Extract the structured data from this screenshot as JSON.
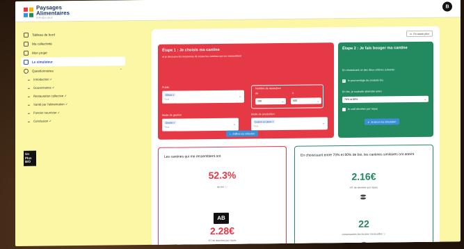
{
  "app": {
    "logo_line1": "Paysages",
    "logo_line2": "Alimentaires",
    "logo_sub": "ÉTAT DES LIEUX",
    "user_initial": "B"
  },
  "sidebar": {
    "items": [
      {
        "label": "Tableau de bord",
        "icon": "home-icon"
      },
      {
        "label": "Ma collectivité",
        "icon": "building-icon"
      },
      {
        "label": "Mon projet",
        "icon": "folder-icon"
      },
      {
        "label": "Le simulateur",
        "icon": "calculator-icon",
        "active": true
      },
      {
        "label": "Questionnaires",
        "icon": "clipboard-icon"
      }
    ],
    "subitems": [
      "Introduction ✓",
      "Gouvernance ✓",
      "Restauration collective ✓",
      "Santé par l'alimentation ✓",
      "Foncier nourricier ✓",
      "Conclusion ✓"
    ],
    "badge": [
      "Un",
      "Plus",
      "BIO"
    ]
  },
  "main": {
    "savoir_plus": "En savoir plus",
    "etape1": {
      "title": "Étape 1 : Je choisis ma cantine",
      "subtitle": "et je découvre les moyennes de toutes les cantines qui me ressemblent",
      "public_label": "Public",
      "public_tag": "Elèves ×",
      "public_placeholder": "Tous",
      "repas_label": "Nombre de repas/jour",
      "de_label": "de",
      "a_label": "à",
      "de_value": "100",
      "a_value": "500",
      "gestion_label": "Mode de gestion",
      "gestion_tag": "Directe ×",
      "gestion_placeholder": "Tous",
      "production_label": "Mode de production",
      "production_tag": "Cuisine sur place ×",
      "production_placeholder": "Tous",
      "button": "J'affine ma sélection"
    },
    "etape2": {
      "title": "Étape 2 : Je fais bouger ma cantine",
      "intro": "En choisissant un des deux critères suivants:",
      "opt1": "le pourcentage de produits bio",
      "bio_label": "En bio, je souhaite atteindre entre",
      "bio_value": "70% et 80%",
      "opt2": "le coût denrées par repas",
      "button": "Je lance ma simulation"
    },
    "card_left": {
      "title": "Les cantines qui me ressemblent ont",
      "pct_bio": "52.3%",
      "pct_caption": "de bio ⓘ",
      "ab_label": "AB",
      "cost": "2.28€",
      "cost_caption": "HT de denrées par repas"
    },
    "card_right": {
      "title": "En choisissant entre 70% et 80% de bio, les cantines similaires ont atteint",
      "cost": "2.16€",
      "cost_caption": "HT de denrées par repas",
      "count": "22",
      "count_caption": "composantes bio locales mensuelles ⓘ"
    }
  },
  "colors": {
    "screen_bg": "#fbf7a4",
    "red": "#e63946",
    "green": "#23895f",
    "blue_button": "#3a8fd6"
  }
}
